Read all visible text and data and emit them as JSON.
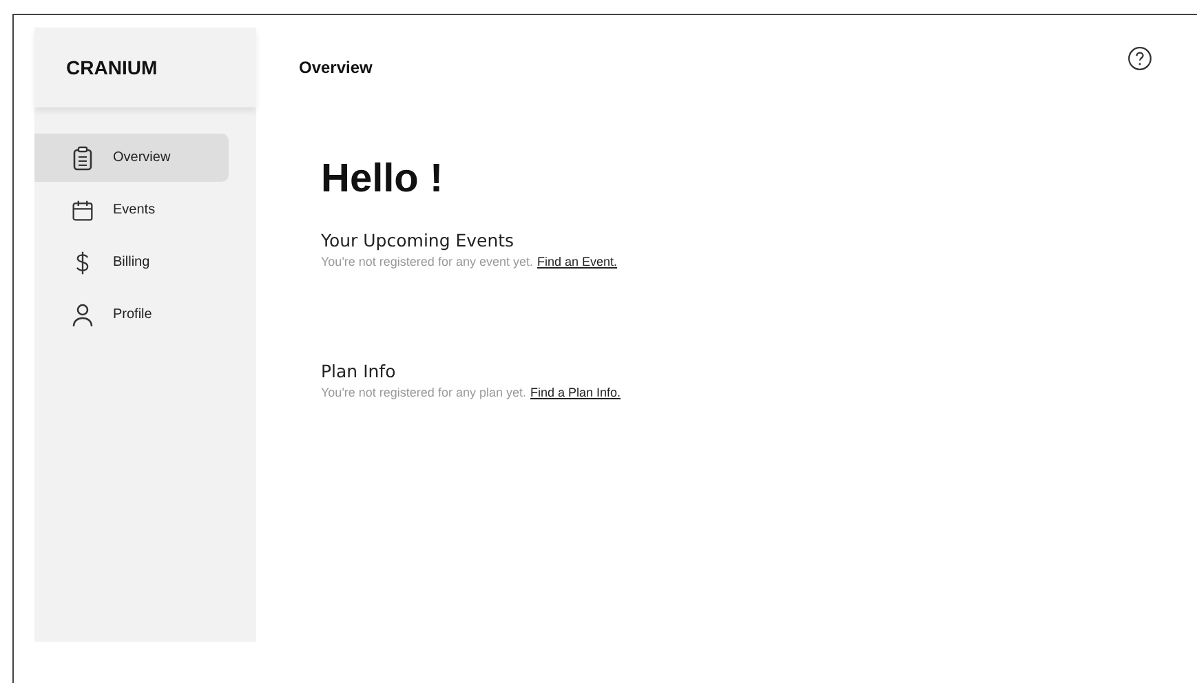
{
  "sidebar": {
    "brand": "CRANIUM",
    "items": [
      {
        "label": "Overview",
        "selected": true
      },
      {
        "label": "Events",
        "selected": false
      },
      {
        "label": "Billing",
        "selected": false
      },
      {
        "label": "Profile",
        "selected": false
      }
    ]
  },
  "header": {
    "title": "Overview"
  },
  "greeting": "Hello !",
  "sections": [
    {
      "title": "Your Upcoming Events",
      "text": "You're not registered for any event yet.",
      "link": "Find an Event."
    },
    {
      "title": "Plan Info",
      "text": "You're not registered for any plan yet.",
      "link": "Find a Plan Info."
    }
  ]
}
